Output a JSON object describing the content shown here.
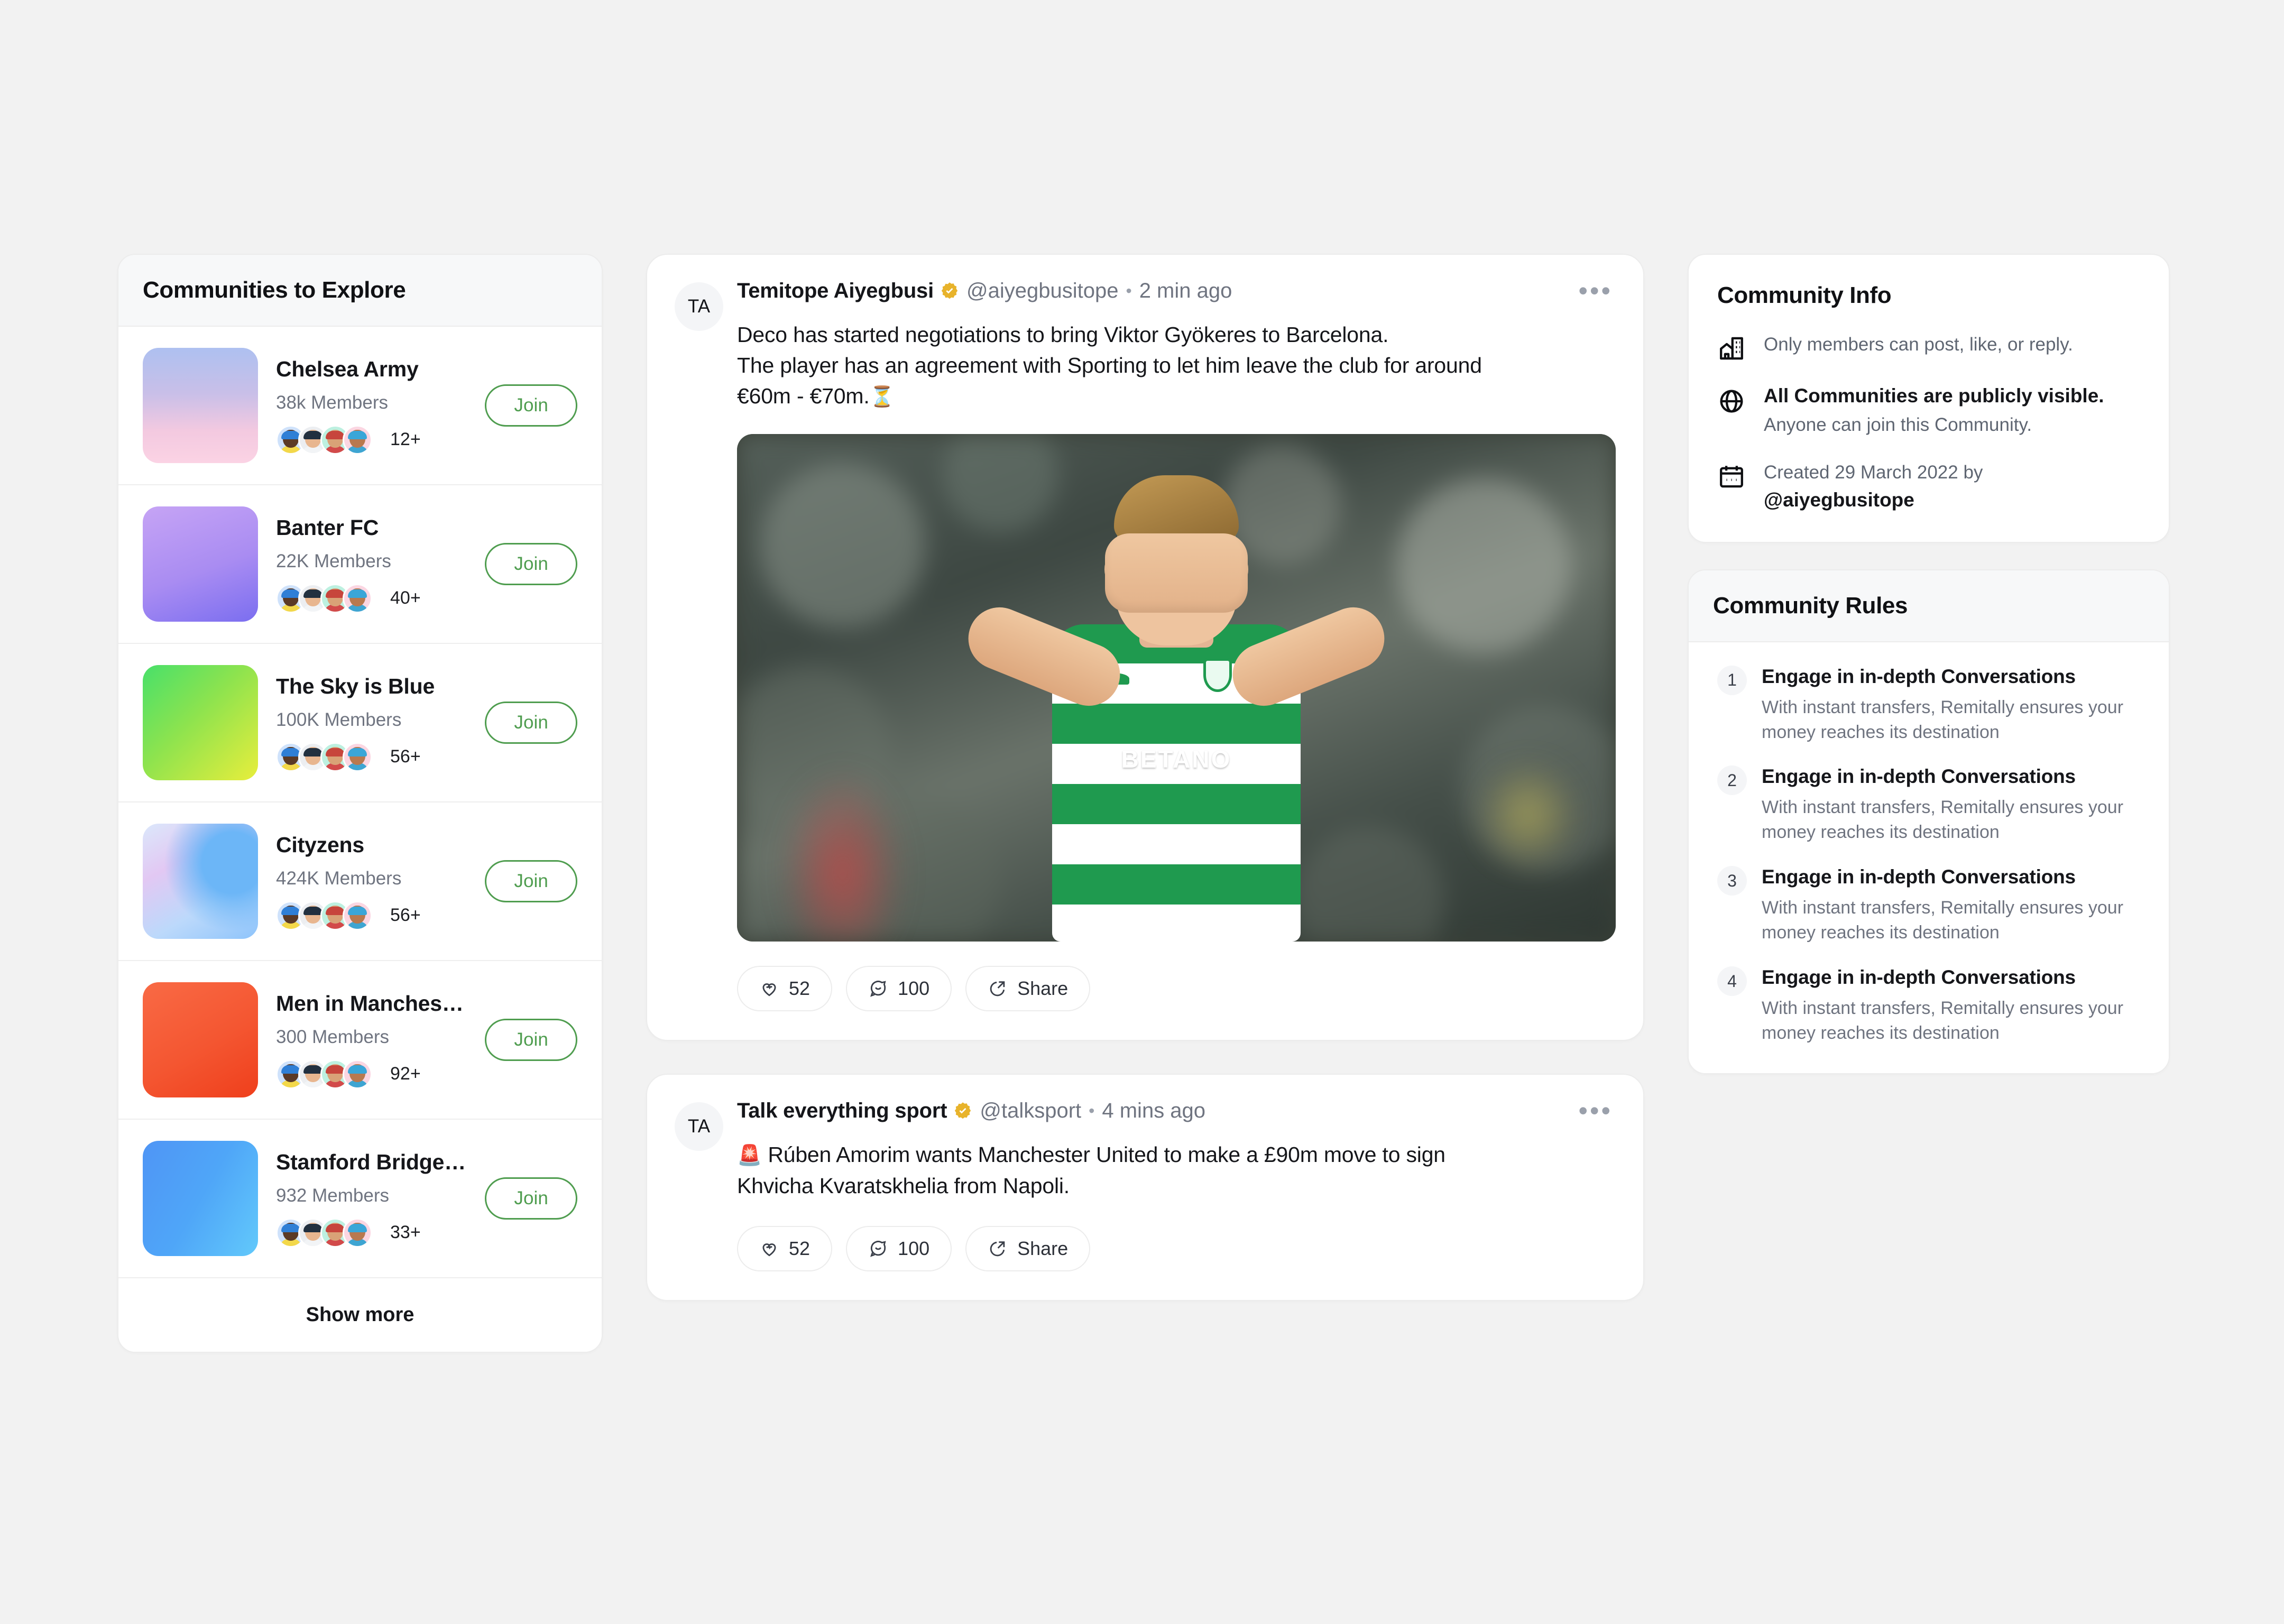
{
  "sidebar": {
    "title": "Communities to Explore",
    "show_more_label": "Show more",
    "join_label": "Join",
    "communities": [
      {
        "name": "Chelsea Army",
        "members": "38k Members",
        "extra": "12+",
        "gradient": "linear-gradient(180deg,#aec0f0 0%,#c9bfe8 40%,#f3c9e0 72%,#fbd3e4 100%)"
      },
      {
        "name": "Banter FC",
        "members": "22K Members",
        "extra": "40+",
        "gradient": "linear-gradient(160deg,#c6a4f5 0%,#a98cf2 55%,#7b6ef0 100%)"
      },
      {
        "name": "The Sky is Blue",
        "members": "100K Members",
        "extra": "56+",
        "gradient": "linear-gradient(135deg,#48e06a 0%,#8ee34e 45%,#e8ee3c 100%)"
      },
      {
        "name": "Cityzens",
        "members": "424K Members",
        "extra": "56+",
        "gradient": "radial-gradient(circle at 78% 34%, #6cb6f7 0 26%, transparent 58%), linear-gradient(150deg,#dbe8fb 0%,#e2c8f3 32%,#bcd9fb 66%,#8ec4fb 100%)"
      },
      {
        "name": "Men in Manchester",
        "members": "300 Members",
        "extra": "92+",
        "gradient": "linear-gradient(150deg,#f96a45 0%,#f45631 55%,#ef3f1c 100%)"
      },
      {
        "name": "Stamford Bridge Sol...",
        "members": "932 Members",
        "extra": "33+",
        "gradient": "linear-gradient(120deg,#4f95f5 0%,#4fa6f8 50%,#62c9fb 100%)"
      }
    ]
  },
  "feed": {
    "posts": [
      {
        "avatar_initials": "TA",
        "author": "Temitope Aiyegbusi",
        "handle": "@aiyegbusitope",
        "time": "2 min ago",
        "verified_icon": "verified-badge-icon",
        "menu_icon": "more-options-icon",
        "text_line1": "Deco has started negotiations to bring Viktor Gyökeres to Barcelona.",
        "text_line2": "The player has an agreement with Sporting to let him leave the club for around",
        "text_line3": "€60m - €70m.",
        "text_emoji": "⏳",
        "has_image": true,
        "image_alt": "Sporting CP footballer celebrating in green and white striped BETANO kit",
        "like_count": "52",
        "comment_count": "100",
        "share_label": "Share"
      },
      {
        "avatar_initials": "TA",
        "author": "Talk everything sport",
        "handle": "@talksport",
        "time": "4 mins ago",
        "verified_icon": "verified-badge-icon",
        "menu_icon": "more-options-icon",
        "text_emoji": "🚨",
        "text_line1": " Rúben Amorim wants Manchester United to make a £90m move to sign",
        "text_line2": "Khvicha Kvaratskhelia from Napoli.",
        "text_line3": "",
        "has_image": false,
        "like_count": "52",
        "comment_count": "100",
        "share_label": "Share"
      }
    ]
  },
  "community_info": {
    "title": "Community Info",
    "rows": [
      {
        "icon": "building-icon",
        "strong": "",
        "text": "Only members can post, like, or reply."
      },
      {
        "icon": "globe-icon",
        "strong": "All Communities are publicly visible.",
        "text": "Anyone can join this Community."
      },
      {
        "icon": "calendar-icon",
        "strong": "",
        "text": "Created 29 March 2022 by",
        "handle": "@aiyegbusitope"
      }
    ]
  },
  "community_rules": {
    "title": "Community Rules",
    "rules": [
      {
        "num": "1",
        "title": "Engage in in-depth Conversations",
        "desc": "With instant transfers, Remitally ensures your money reaches its destination"
      },
      {
        "num": "2",
        "title": "Engage in in-depth Conversations",
        "desc": "With instant transfers, Remitally ensures your money reaches its destination"
      },
      {
        "num": "3",
        "title": "Engage in in-depth Conversations",
        "desc": "With instant transfers, Remitally ensures your money reaches its destination"
      },
      {
        "num": "4",
        "title": "Engage in in-depth Conversations",
        "desc": "With instant transfers, Remitally ensures your money reaches its destination"
      }
    ]
  },
  "colors": {
    "page_bg": "#f2f2f2",
    "accent_join": "#4f9d4f",
    "verified": "#e8b32b",
    "text_primary": "#15161a",
    "text_muted": "#6f7480"
  }
}
